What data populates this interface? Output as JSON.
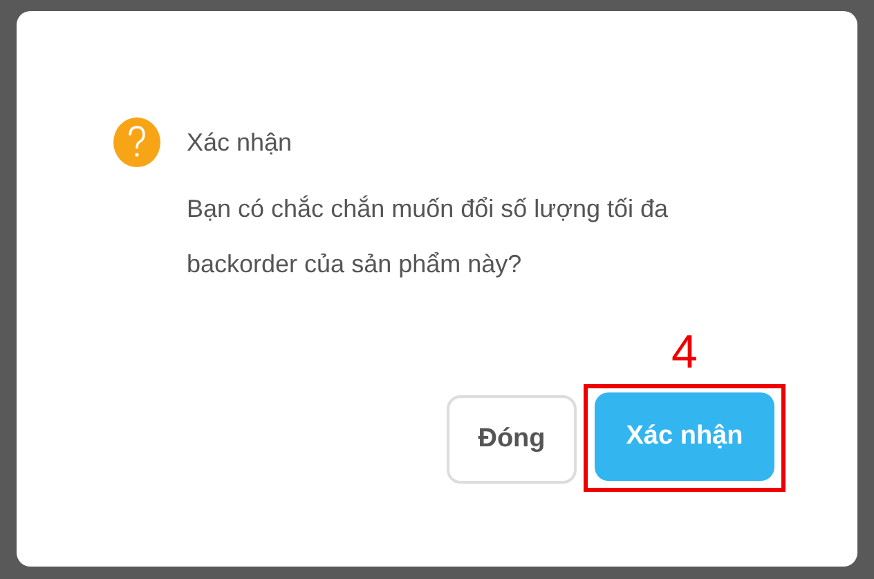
{
  "dialog": {
    "title": "Xác nhận",
    "message": "Bạn có chắc chắn muốn đổi số lượng tối đa backorder của sản phẩm này?",
    "buttons": [
      {
        "label": "Đóng",
        "kind": "secondary"
      },
      {
        "label": "Xác nhận",
        "kind": "primary"
      }
    ]
  },
  "annotation": {
    "label": "4"
  }
}
